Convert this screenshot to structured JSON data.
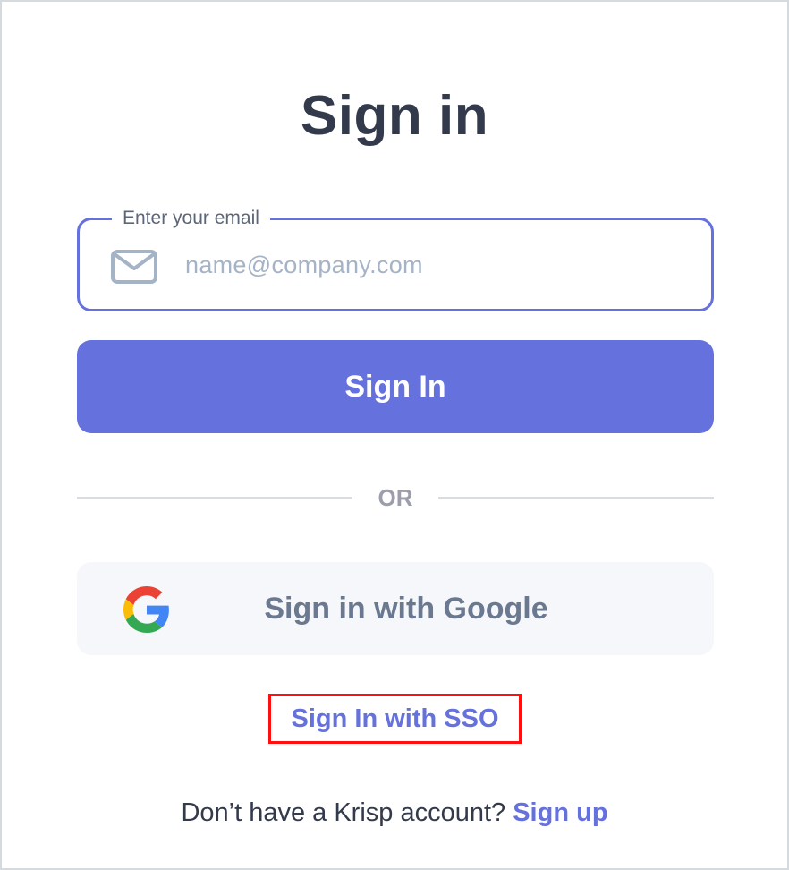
{
  "page": {
    "title": "Sign in"
  },
  "email": {
    "label": "Enter your email",
    "placeholder": "name@company.com",
    "value": ""
  },
  "buttons": {
    "sign_in": "Sign In",
    "google": "Sign in with Google",
    "sso": "Sign In with SSO"
  },
  "divider": {
    "text": "OR"
  },
  "footer": {
    "prompt": "Don’t have a Krisp account?",
    "signup_link": "Sign up"
  },
  "icons": {
    "email": "mail-icon",
    "google": "google-icon"
  },
  "colors": {
    "accent": "#6571dd",
    "title": "#333a4c",
    "placeholder": "#a5b3c6",
    "google_label": "#6a7890",
    "google_bg": "#f5f7fa",
    "highlight_box": "#ff1010"
  }
}
